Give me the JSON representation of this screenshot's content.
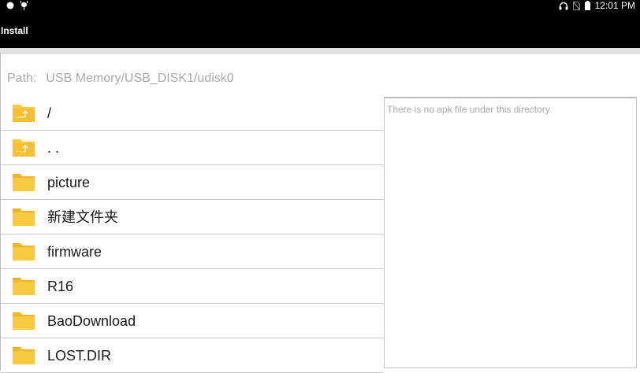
{
  "status_bar": {
    "time": "12:01 PM",
    "icons": [
      "circle-notification-icon",
      "android-debug-icon",
      "headphones-icon",
      "no-sim-icon",
      "battery-icon"
    ]
  },
  "action_bar": {
    "title": "Install"
  },
  "path": {
    "label": "Path:",
    "value": "USB Memory/USB_DISK1/udisk0"
  },
  "files": [
    {
      "name": "/",
      "icon": "folder-up-icon"
    },
    {
      "name": ". .",
      "icon": "folder-up-icon"
    },
    {
      "name": "picture",
      "icon": "folder-icon"
    },
    {
      "name": "新建文件夹",
      "icon": "folder-icon"
    },
    {
      "name": "firmware",
      "icon": "folder-icon"
    },
    {
      "name": "R16",
      "icon": "folder-icon"
    },
    {
      "name": "BaoDownload",
      "icon": "folder-icon"
    },
    {
      "name": "LOST.DIR",
      "icon": "folder-icon"
    }
  ],
  "apk_panel": {
    "message": "There is no apk file under this directory"
  },
  "colors": {
    "folder": "#f9c941",
    "folder_dark": "#efb52c",
    "bar": "#000000"
  }
}
